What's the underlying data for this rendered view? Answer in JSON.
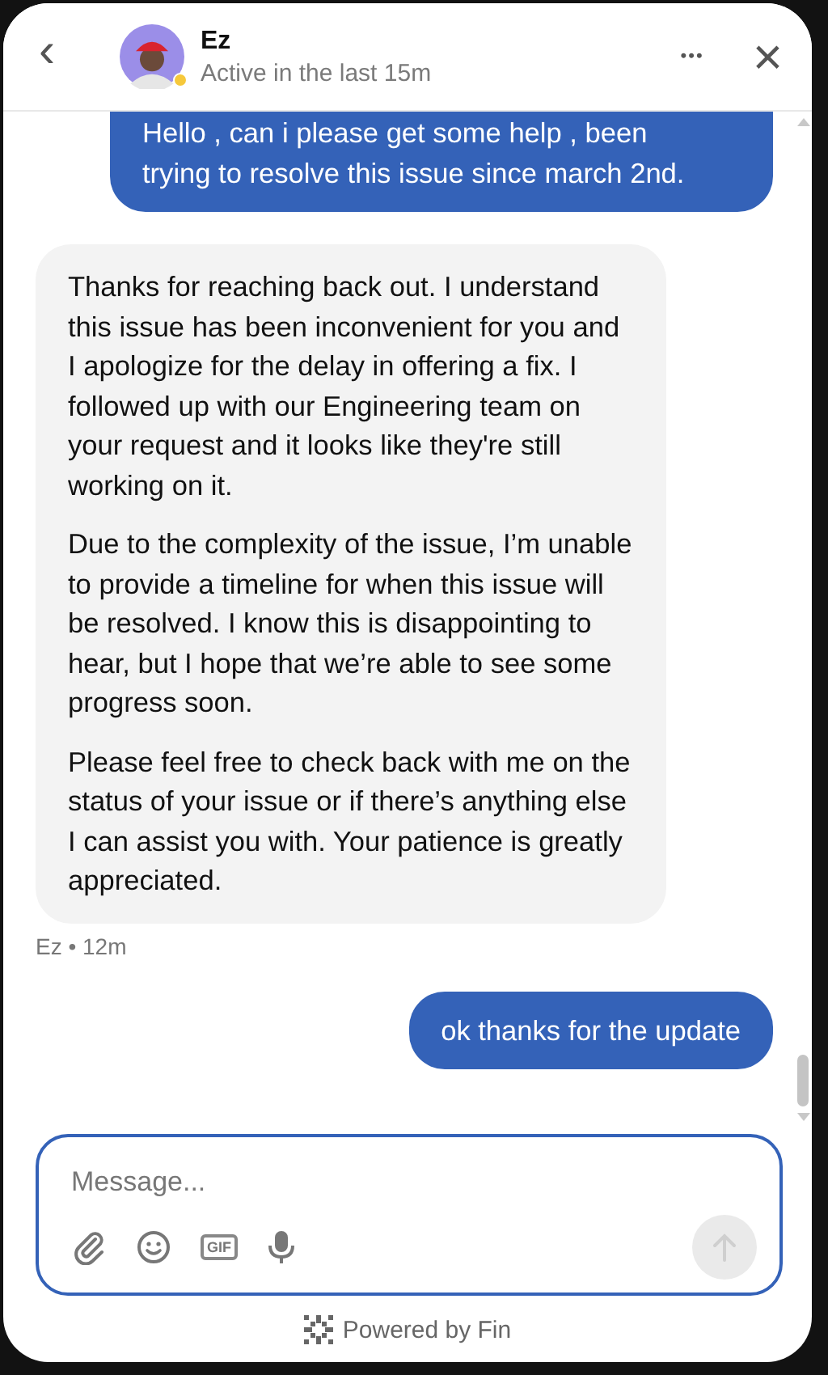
{
  "header": {
    "back": "‹",
    "name": "Ez",
    "status": "Active in the last 15m",
    "online": true,
    "more": "•••",
    "close": "×"
  },
  "messages": [
    {
      "kind": "user",
      "paragraphs": [
        "Hello , can i please get some help , been trying to resolve this issue since march 2nd."
      ]
    },
    {
      "kind": "agent",
      "paragraphs": [
        "Thanks for reaching back out. I understand this issue has been inconvenient for you and I apologize for the delay in offering a fix. I followed up with our Engineering team on your request and it looks like they're still working on it.",
        "Due to the complexity of the issue, I’m unable to provide a timeline for when this issue will be resolved. I know this is disappointing to hear, but I hope that we’re able to see some progress soon.",
        "Please feel free to check back with me on the status of your issue or if there’s anything else I can assist you with. Your patience is greatly appreciated."
      ],
      "meta": "Ez • 12m"
    },
    {
      "kind": "user",
      "paragraphs": [
        "ok thanks for the update"
      ]
    }
  ],
  "composer": {
    "placeholder": "Message...",
    "gif": "GIF",
    "send_disabled": true
  },
  "footer": {
    "text": "Powered by Fin"
  }
}
